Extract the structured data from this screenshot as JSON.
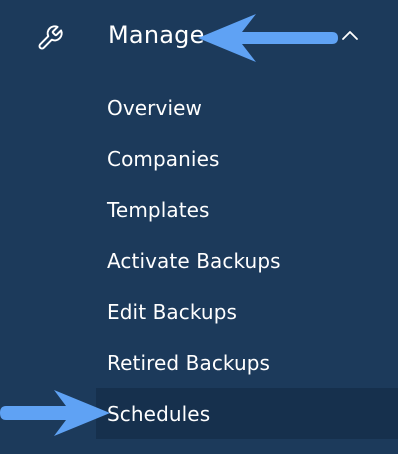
{
  "section": {
    "title": "Manage",
    "icon": "wrench-icon",
    "expand_icon": "chevron-up-icon"
  },
  "menu": {
    "items": [
      {
        "label": "Overview"
      },
      {
        "label": "Companies"
      },
      {
        "label": "Templates"
      },
      {
        "label": "Activate Backups"
      },
      {
        "label": "Edit Backups"
      },
      {
        "label": "Retired Backups"
      },
      {
        "label": "Schedules"
      }
    ],
    "active_item": "Schedules"
  },
  "annotations": {
    "arrow_color": "#5fa2f4",
    "icons": [
      "arrow-left-annotation",
      "arrow-right-annotation"
    ]
  },
  "colors": {
    "background": "#1c3a5b",
    "active_background": "#16304d",
    "text": "#ffffff"
  }
}
